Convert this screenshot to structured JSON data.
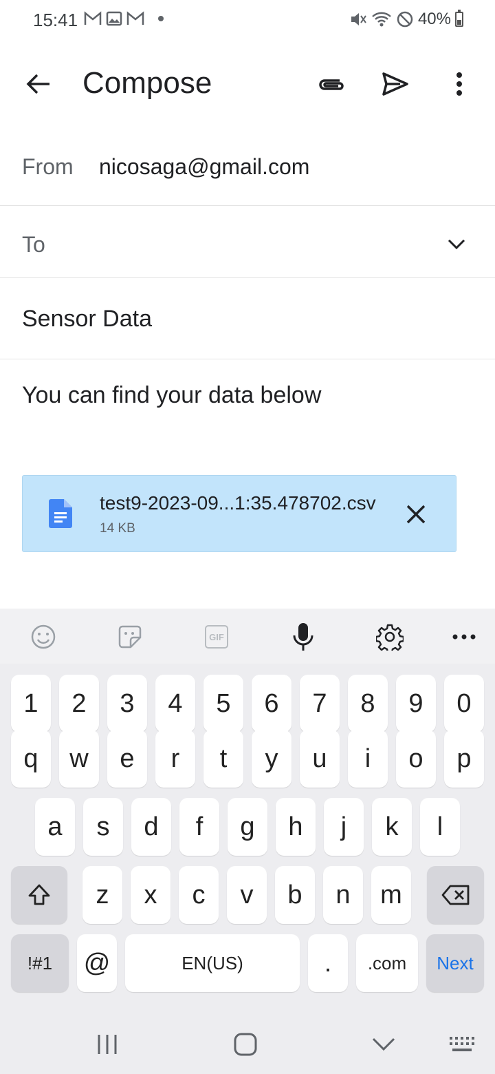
{
  "status_bar": {
    "time": "15:41",
    "battery": "40%",
    "battery_level": 0.4
  },
  "app_bar": {
    "title": "Compose"
  },
  "from": {
    "label": "From",
    "value": "nicosaga@gmail.com"
  },
  "to": {
    "label": "To",
    "value": ""
  },
  "subject": {
    "value": "Sensor Data"
  },
  "body": {
    "text": "You can find your data below"
  },
  "attachment": {
    "name": "test9-2023-09...1:35.478702.csv",
    "size": "14 KB"
  },
  "keyboard": {
    "toolbar_gif": "GIF",
    "row_numbers": [
      "1",
      "2",
      "3",
      "4",
      "5",
      "6",
      "7",
      "8",
      "9",
      "0"
    ],
    "row_1": [
      "q",
      "w",
      "e",
      "r",
      "t",
      "y",
      "u",
      "i",
      "o",
      "p"
    ],
    "row_2": [
      "a",
      "s",
      "d",
      "f",
      "g",
      "h",
      "j",
      "k",
      "l"
    ],
    "row_3": [
      "z",
      "x",
      "c",
      "v",
      "b",
      "n",
      "m"
    ],
    "symbols_key": "!#1",
    "at_key": "@",
    "space_key": "EN(US)",
    "period_key": ".",
    "com_key": ".com",
    "next_key": "Next"
  },
  "colors": {
    "attachment_bg": "#c2e4fb",
    "doc_icon": "#4285f4",
    "next_key": "#1a73e8"
  }
}
